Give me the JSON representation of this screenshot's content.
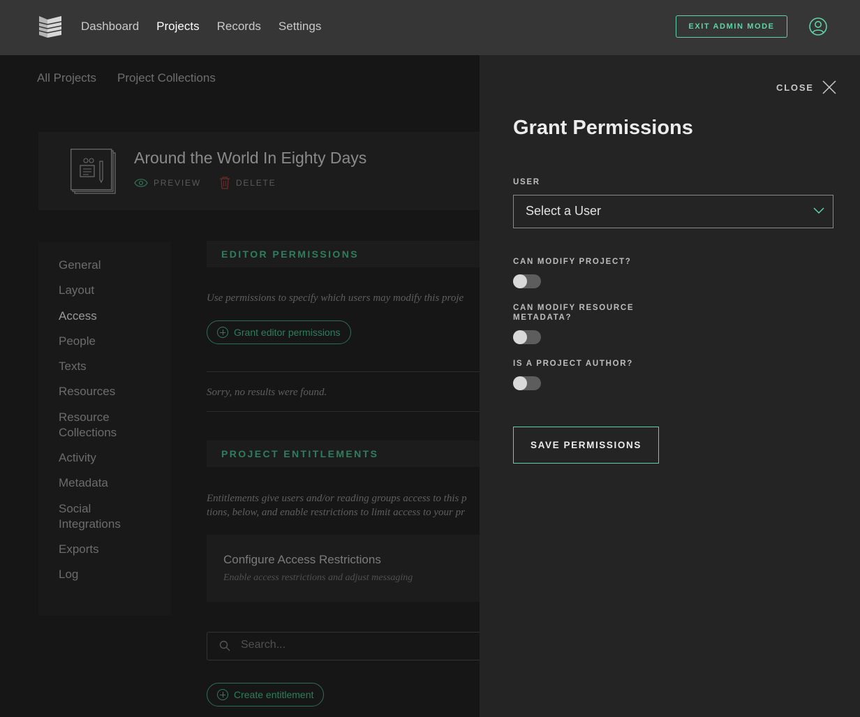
{
  "header": {
    "nav": [
      "Dashboard",
      "Projects",
      "Records",
      "Settings"
    ],
    "active_nav": "Projects",
    "exit_button": "EXIT ADMIN MODE"
  },
  "subnav": [
    "All Projects",
    "Project Collections"
  ],
  "project": {
    "title": "Around the World In Eighty Days",
    "preview_label": "PREVIEW",
    "delete_label": "DELETE"
  },
  "sidemenu": {
    "items": [
      "General",
      "Layout",
      "Access",
      "People",
      "Texts",
      "Resources",
      "Resource Collections",
      "Activity",
      "Metadata",
      "Social Integrations",
      "Exports",
      "Log"
    ],
    "active": "Access"
  },
  "editor_permissions": {
    "heading": "EDITOR PERMISSIONS",
    "description": "Use permissions to specify which users may modify this proje",
    "grant_button": "Grant editor permissions",
    "empty_message": "Sorry, no results were found."
  },
  "entitlements": {
    "heading": "PROJECT ENTITLEMENTS",
    "description_line1": "Entitlements give users and/or reading groups access to this p",
    "description_line2": "tions, below, and enable restrictions to limit access to your pr",
    "access_title": "Configure Access Restrictions",
    "access_subtitle": "Enable access restrictions and adjust messaging",
    "search_placeholder": "Search...",
    "create_button": "Create entitlement"
  },
  "drawer": {
    "close_label": "CLOSE",
    "title": "Grant Permissions",
    "user_label": "USER",
    "user_select_value": "Select a User",
    "can_modify_project_label": "CAN MODIFY PROJECT?",
    "can_modify_project": false,
    "can_modify_metadata_label": "CAN MODIFY RESOURCE METADATA?",
    "can_modify_metadata": false,
    "is_author_label": "IS A PROJECT AUTHOR?",
    "is_author": false,
    "save_button": "SAVE PERMISSIONS"
  },
  "colors": {
    "accent": "#5fd3a8",
    "header_bg": "#363636",
    "drawer_bg": "#242424"
  }
}
